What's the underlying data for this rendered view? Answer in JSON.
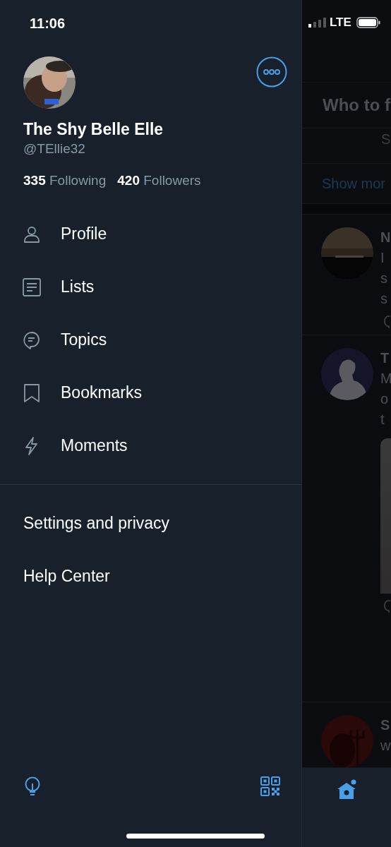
{
  "status_bar": {
    "time": "11:06",
    "network": "LTE"
  },
  "profile": {
    "name": "The Shy Belle Elle",
    "handle": "@TEllie32",
    "following_count": "335",
    "following_label": "Following",
    "followers_count": "420",
    "followers_label": "Followers"
  },
  "menu": [
    {
      "label": "Profile",
      "kind": "person"
    },
    {
      "label": "Lists",
      "kind": "list"
    },
    {
      "label": "Topics",
      "kind": "topic"
    },
    {
      "label": "Bookmarks",
      "kind": "bookmark"
    },
    {
      "label": "Moments",
      "kind": "bolt"
    }
  ],
  "secondary_menu": [
    "Settings and privacy",
    "Help Center"
  ],
  "background": {
    "header": "Who to f",
    "suggestion": "S",
    "show_more": "Show mor",
    "tweets": [
      {
        "name": "N",
        "lines": [
          "I",
          "s",
          "s"
        ],
        "media": false,
        "actions": true
      },
      {
        "name": "T",
        "lines": [
          "M",
          "o",
          "t"
        ],
        "media": true,
        "actions": true
      },
      {
        "name": "S",
        "lines": [
          "w"
        ],
        "media": false,
        "actions": false
      }
    ]
  }
}
